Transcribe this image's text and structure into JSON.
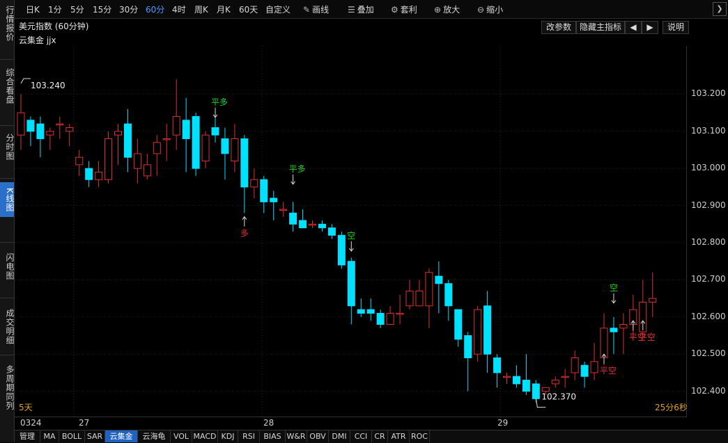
{
  "leftnav": {
    "items": [
      {
        "label": "行情报价",
        "active": false
      },
      {
        "label": "综合看盘",
        "active": false
      },
      {
        "label": "分时图",
        "active": false
      },
      {
        "label": "K线图",
        "active": true
      },
      {
        "label": "闪电图",
        "active": false
      },
      {
        "label": "成交明细",
        "active": false
      },
      {
        "label": "多周期同列",
        "active": false
      }
    ]
  },
  "toolbar": {
    "periods": [
      "日K",
      "1分",
      "5分",
      "15分",
      "30分",
      "60分",
      "4时",
      "周K",
      "月K",
      "60天",
      "自定义"
    ],
    "active_period": "60分",
    "draw_label": "画线",
    "overlay_label": "叠加",
    "arbitrage_label": "套利",
    "zoom_in_label": "放大",
    "zoom_out_label": "缩小"
  },
  "header": {
    "title": "美元指数 (60分钟)",
    "indicator": "云集金 jjx",
    "buttons": {
      "params": "改参数",
      "hide_main": "隐藏主指标",
      "prev": "◀",
      "next": "▶",
      "help": "说明"
    }
  },
  "chart_data": {
    "type": "candlestick",
    "y_axis": {
      "ticks": [
        "103.200",
        "103.100",
        "103.000",
        "102.900",
        "102.800",
        "102.700",
        "102.600",
        "102.500",
        "102.400"
      ],
      "range": [
        102.33,
        103.33
      ]
    },
    "x_axis": {
      "labels": [
        "0324",
        "27",
        "28",
        "29"
      ]
    },
    "high_marker": "103.240",
    "low_marker": "102.370",
    "signals": [
      "平多",
      "多",
      "平多",
      "空",
      "平空",
      "空",
      "平空",
      "平空"
    ],
    "candles": [
      [
        103.09,
        103.15,
        103.2,
        103.05
      ],
      [
        103.13,
        103.1,
        103.14,
        103.06
      ],
      [
        103.12,
        103.08,
        103.14,
        103.03
      ],
      [
        103.09,
        103.1,
        103.11,
        103.05
      ],
      [
        103.12,
        103.12,
        103.14,
        103.08
      ],
      [
        103.1,
        103.11,
        103.12,
        103.06
      ],
      [
        103.01,
        103.03,
        103.05,
        102.98
      ],
      [
        103.0,
        102.97,
        103.02,
        102.95
      ],
      [
        102.97,
        102.99,
        103.02,
        102.95
      ],
      [
        102.97,
        103.08,
        103.1,
        102.96
      ],
      [
        103.09,
        103.1,
        103.12,
        103.01
      ],
      [
        103.12,
        103.03,
        103.16,
        102.99
      ],
      [
        103.0,
        103.04,
        103.08,
        102.96
      ],
      [
        102.98,
        103.01,
        103.04,
        102.97
      ],
      [
        103.04,
        103.07,
        103.09,
        102.98
      ],
      [
        103.08,
        103.08,
        103.12,
        103.02
      ],
      [
        103.09,
        103.14,
        103.24,
        103.05
      ],
      [
        103.13,
        103.08,
        103.19,
        102.99
      ],
      [
        103.14,
        103.0,
        103.15,
        102.98
      ],
      [
        103.02,
        103.09,
        103.1,
        103.0
      ],
      [
        103.11,
        103.09,
        103.14,
        103.07
      ],
      [
        103.08,
        103.04,
        103.11,
        102.97
      ],
      [
        103.02,
        103.08,
        103.12,
        102.99
      ],
      [
        103.08,
        102.95,
        103.09,
        102.88
      ],
      [
        102.95,
        102.97,
        103.0,
        102.92
      ],
      [
        102.97,
        102.91,
        102.98,
        102.88
      ],
      [
        102.92,
        102.91,
        102.94,
        102.86
      ],
      [
        102.89,
        102.89,
        102.91,
        102.87
      ],
      [
        102.88,
        102.85,
        102.91,
        102.83
      ],
      [
        102.86,
        102.84,
        102.89,
        102.84
      ],
      [
        102.85,
        102.85,
        102.86,
        102.84
      ],
      [
        102.85,
        102.84,
        102.86,
        102.83
      ],
      [
        102.84,
        102.82,
        102.85,
        102.81
      ],
      [
        102.82,
        102.74,
        102.83,
        102.73
      ],
      [
        102.75,
        102.63,
        102.76,
        102.58
      ],
      [
        102.62,
        102.61,
        102.65,
        102.6
      ],
      [
        102.62,
        102.61,
        102.65,
        102.59
      ],
      [
        102.61,
        102.58,
        102.62,
        102.57
      ],
      [
        102.58,
        102.61,
        102.63,
        102.58
      ],
      [
        102.61,
        102.61,
        102.66,
        102.58
      ],
      [
        102.63,
        102.67,
        102.7,
        102.62
      ],
      [
        102.63,
        102.67,
        102.7,
        102.63
      ],
      [
        102.63,
        102.72,
        102.73,
        102.57
      ],
      [
        102.71,
        102.69,
        102.75,
        102.61
      ],
      [
        102.69,
        102.63,
        102.7,
        102.59
      ],
      [
        102.62,
        102.54,
        102.62,
        102.52
      ],
      [
        102.55,
        102.49,
        102.56,
        102.4
      ],
      [
        102.5,
        102.62,
        102.63,
        102.48
      ],
      [
        102.63,
        102.5,
        102.67,
        102.45
      ],
      [
        102.49,
        102.45,
        102.5,
        102.41
      ],
      [
        102.44,
        102.44,
        102.45,
        102.42
      ],
      [
        102.44,
        102.42,
        102.47,
        102.41
      ],
      [
        102.43,
        102.4,
        102.5,
        102.39
      ],
      [
        102.42,
        102.38,
        102.43,
        102.37
      ],
      [
        102.4,
        102.41,
        102.41,
        102.39
      ],
      [
        102.42,
        102.43,
        102.44,
        102.41
      ],
      [
        102.44,
        102.44,
        102.46,
        102.41
      ],
      [
        102.45,
        102.49,
        102.51,
        102.43
      ],
      [
        102.47,
        102.44,
        102.48,
        102.41
      ],
      [
        102.45,
        102.48,
        102.53,
        102.43
      ],
      [
        102.49,
        102.57,
        102.61,
        102.47
      ],
      [
        102.57,
        102.56,
        102.6,
        102.5
      ],
      [
        102.57,
        102.58,
        102.61,
        102.5
      ],
      [
        102.58,
        102.62,
        102.66,
        102.54
      ],
      [
        102.56,
        102.64,
        102.7,
        102.55
      ],
      [
        102.64,
        102.65,
        102.72,
        102.6
      ]
    ]
  },
  "footer": {
    "period_label": "5天",
    "timer_label": "25分6秒"
  },
  "tabs": [
    "管理",
    "MA",
    "BOLL",
    "SAR",
    "云集金",
    "云海龟",
    "VOL",
    "MACD",
    "KDJ",
    "RSI",
    "BIAS",
    "W&R",
    "OBV",
    "DMI",
    "CCI",
    "CR",
    "ATR",
    "ROC"
  ],
  "active_tab": "云集金",
  "colors": {
    "up": "#e03030",
    "down": "#00e0ff",
    "accent": "#2a6fc9",
    "signal_green": "#20d020",
    "signal_red": "#e03030"
  }
}
